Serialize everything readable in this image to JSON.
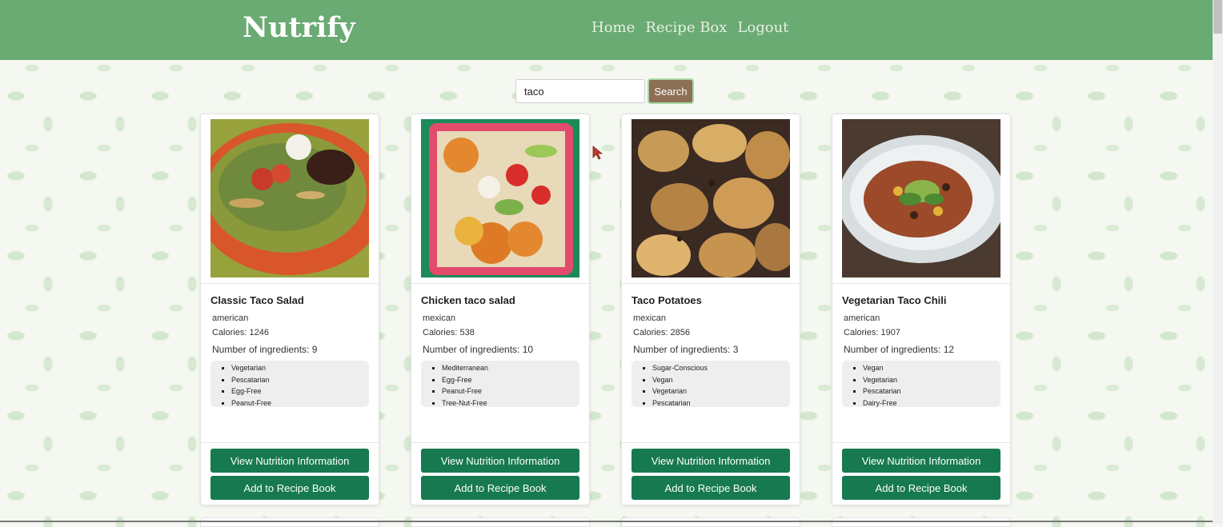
{
  "brand": "Nutrify",
  "nav": [
    "Home",
    "Recipe Box",
    "Logout"
  ],
  "search": {
    "value": "taco",
    "button": "Search"
  },
  "buttons": {
    "view": "View Nutrition Information",
    "add": "Add to Recipe Book"
  },
  "recipes": [
    {
      "title": "Classic Taco Salad",
      "cuisine": "american",
      "calories": "Calories: 1246",
      "ingredients": "Number of ingredients: 9",
      "labels": [
        "Vegetarian",
        "Pescatarian",
        "Egg-Free",
        "Peanut-Free"
      ]
    },
    {
      "title": "Chicken taco salad",
      "cuisine": "mexican",
      "calories": "Calories: 538",
      "ingredients": "Number of ingredients: 10",
      "labels": [
        "Mediterranean",
        "Egg-Free",
        "Peanut-Free",
        "Tree-Nut-Free"
      ]
    },
    {
      "title": "Taco Potatoes",
      "cuisine": "mexican",
      "calories": "Calories: 2856",
      "ingredients": "Number of ingredients: 3",
      "labels": [
        "Sugar-Conscious",
        "Vegan",
        "Vegetarian",
        "Pescatarian"
      ]
    },
    {
      "title": "Vegetarian Taco Chili",
      "cuisine": "american",
      "calories": "Calories: 1907",
      "ingredients": "Number of ingredients: 12",
      "labels": [
        "Vegan",
        "Vegetarian",
        "Pescatarian",
        "Dairy-Free"
      ]
    }
  ],
  "colors": {
    "navbar": "#6aaa73",
    "button": "#16794f",
    "search_button": "#8c6f55"
  }
}
